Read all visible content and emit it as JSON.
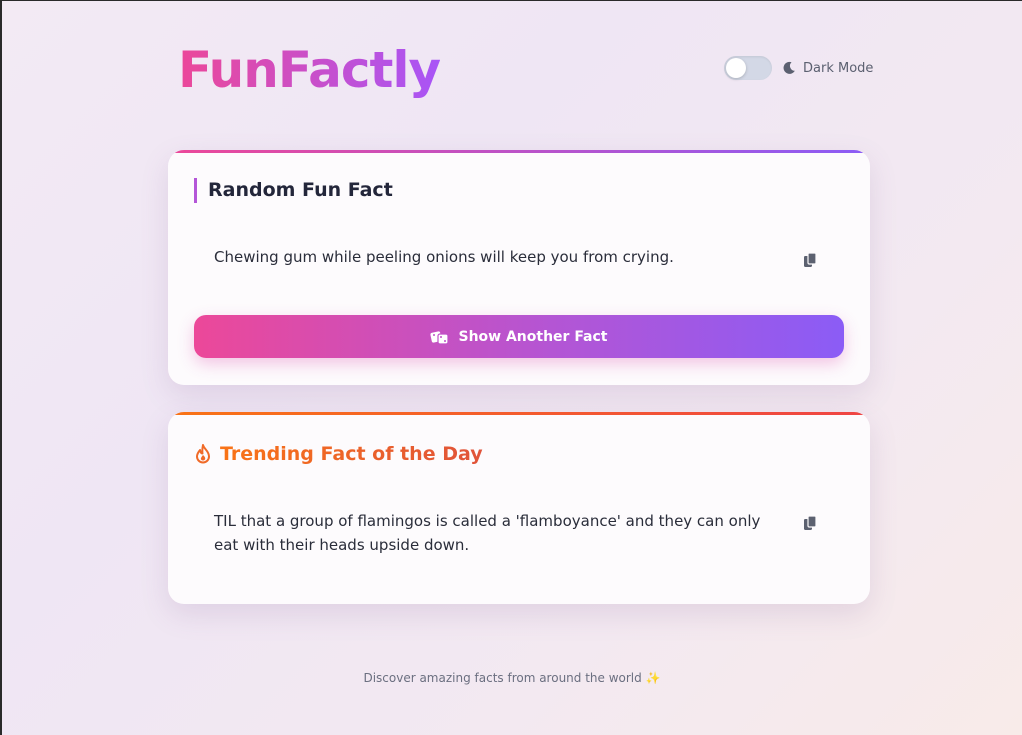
{
  "header": {
    "logo": "FunFactly",
    "theme_toggle": {
      "label": "Dark Mode",
      "enabled": false,
      "icon": "moon-icon"
    }
  },
  "random_card": {
    "title": "Random Fun Fact",
    "fact": "Chewing gum while peeling onions will keep you from crying.",
    "copy_icon": "copy-icon",
    "button_label": "Show Another Fact",
    "button_icon": "dice-icon"
  },
  "trending_card": {
    "title": "Trending Fact of the Day",
    "title_icon": "fire-icon",
    "fact": "TIL that a group of flamingos is called a 'flamboyance' and they can only eat with their heads upside down.",
    "copy_icon": "copy-icon"
  },
  "footer": {
    "text": "Discover amazing facts from around the world ✨"
  },
  "colors": {
    "brand_pink": "#ec4899",
    "brand_purple": "#8b5cf6",
    "trend_orange": "#f97316",
    "trend_red": "#ef4444"
  }
}
